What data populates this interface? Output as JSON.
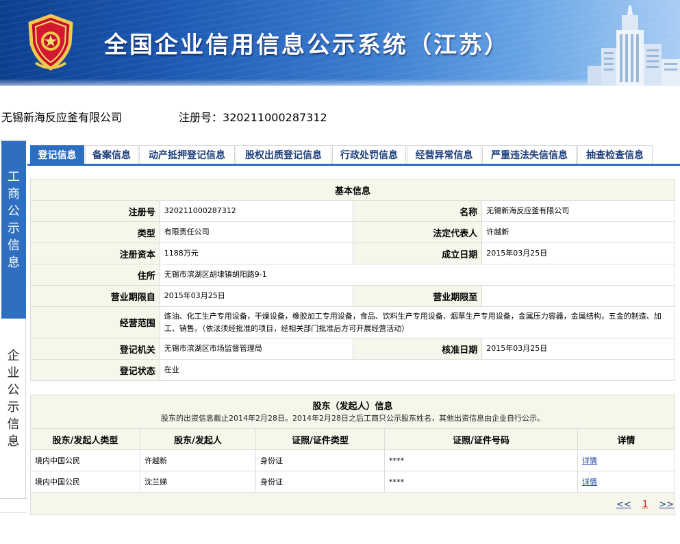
{
  "banner": {
    "title": "全国企业信用信息公示系统（江苏）"
  },
  "company": {
    "name": "无锡新海反应釜有限公司",
    "reg_label": "注册号：",
    "reg_no": "320211000287312"
  },
  "side_nav": {
    "gongshang": [
      "工",
      "商",
      "公",
      "示",
      "信",
      "息"
    ],
    "qiye": [
      "企",
      "业",
      "公",
      "示",
      "信",
      "息"
    ]
  },
  "tabs": [
    {
      "label": "登记信息",
      "active": true
    },
    {
      "label": "备案信息",
      "active": false
    },
    {
      "label": "动产抵押登记信息",
      "active": false
    },
    {
      "label": "股权出质登记信息",
      "active": false
    },
    {
      "label": "行政处罚信息",
      "active": false
    },
    {
      "label": "经营异常信息",
      "active": false
    },
    {
      "label": "严重违法失信信息",
      "active": false
    },
    {
      "label": "抽查检查信息",
      "active": false
    }
  ],
  "basic_info": {
    "caption": "基本信息",
    "reg_no_label": "注册号",
    "reg_no": "320211000287312",
    "name_label": "名称",
    "name": "无锡新海反应釜有限公司",
    "type_label": "类型",
    "type": "有限责任公司",
    "legal_rep_label": "法定代表人",
    "legal_rep": "许越新",
    "capital_label": "注册资本",
    "capital": "1188万元",
    "founded_label": "成立日期",
    "founded": "2015年03月25日",
    "address_label": "住所",
    "address": "无锡市滨湖区胡埭镇胡阳路9-1",
    "term_from_label": "营业期限自",
    "term_from": "2015年03月25日",
    "term_to_label": "营业期限至",
    "term_to": "",
    "scope_label": "经营范围",
    "scope": "炼油、化工生产专用设备，干燥设备，橡胶加工专用设备，食品、饮料生产专用设备、烟草生产专用设备，金属压力容器，金属结构，五金的制造、加工、销售。（依法须经批准的项目，经相关部门批准后方可开展经营活动）",
    "authority_label": "登记机关",
    "authority": "无锡市滨湖区市场监督管理局",
    "approval_label": "核准日期",
    "approval": "2015年03月25日",
    "status_label": "登记状态",
    "status": "在业"
  },
  "shareholders": {
    "title": "股东（发起人）信息",
    "note": "股东的出资信息截止2014年2月28日。2014年2月28日之后工商只公示股东姓名，其他出资信息由企业自行公示。",
    "headers": [
      "股东/发起人类型",
      "股东/发起人",
      "证照/证件类型",
      "证照/证件号码",
      "详情"
    ],
    "rows": [
      {
        "type": "境内中国公民",
        "name": "许越新",
        "id_type": "身份证",
        "id_no": "****",
        "detail": "详情"
      },
      {
        "type": "境内中国公民",
        "name": "沈兰娣",
        "id_type": "身份证",
        "id_no": "****",
        "detail": "详情"
      }
    ],
    "pager": {
      "prev": "<<",
      "page": "1",
      "next": ">>"
    }
  }
}
